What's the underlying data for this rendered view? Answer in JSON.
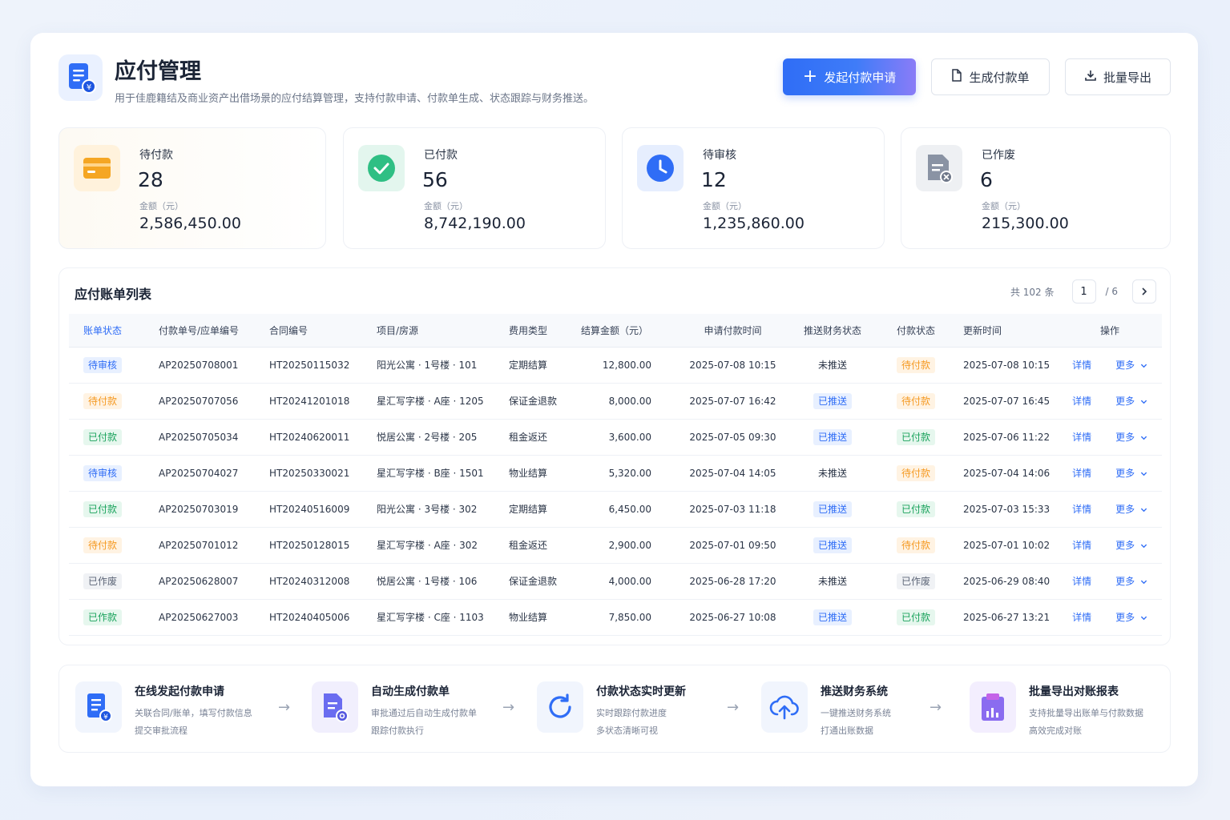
{
  "header": {
    "title": "应付管理",
    "description": "用于佳鹿籍结及商业资产出借场景的应付结算管理，支持付款申请、付款单生成、状态跟踪与财务推送。",
    "icon": "document-yuan-icon",
    "buttons": {
      "create": "发起付款申请",
      "generate": "生成付款单",
      "export": "批量导出"
    }
  },
  "stats": [
    {
      "label": "待付款",
      "count": "28",
      "sub": "金额（元）",
      "amount": "2,586,450.00",
      "icon": "wallet-icon",
      "color": "#f5a623"
    },
    {
      "label": "已付款",
      "count": "56",
      "sub": "金额（元）",
      "amount": "8,742,190.00",
      "icon": "check-circle-icon",
      "color": "#2fbf84"
    },
    {
      "label": "待审核",
      "count": "12",
      "sub": "金额（元）",
      "amount": "1,235,860.00",
      "icon": "clock-icon",
      "color": "#2f6df6"
    },
    {
      "label": "已作废",
      "count": "6",
      "sub": "金额（元）",
      "amount": "215,300.00",
      "icon": "void-document-icon",
      "color": "#8a93a4"
    }
  ],
  "table": {
    "title": "应付账单列表",
    "pager": {
      "total": "共 102 条",
      "current": "1",
      "pages": "/ 6"
    },
    "columns": [
      "账单状态",
      "付款单号/应单编号",
      "合同编号",
      "项目/房源",
      "费用类型",
      "结算金额（元）",
      "申请付款时间",
      "推送财务状态",
      "付款状态",
      "更新时间",
      "操作"
    ],
    "rows": [
      {
        "status": "待审核",
        "status_tone": "blue",
        "pay_no": "AP20250708001",
        "contract": "HT20250115032",
        "project": "阳光公寓 · 1号楼 · 101",
        "fee": "定期结算",
        "amount": "12,800.00",
        "apply_time": "2025-07-08 10:15",
        "push": "未推送",
        "push_tone": "plain",
        "pay_status": "待付款",
        "pay_tone": "orange",
        "updated": "2025-07-08 10:15",
        "detail": "详情",
        "more": "更多"
      },
      {
        "status": "待付款",
        "status_tone": "orange",
        "pay_no": "AP20250707056",
        "contract": "HT20241201018",
        "project": "星汇写字楼 · A座 · 1205",
        "fee": "保证金退款",
        "amount": "8,000.00",
        "apply_time": "2025-07-07 16:42",
        "push": "已推送",
        "push_tone": "blue",
        "pay_status": "待付款",
        "pay_tone": "orange",
        "updated": "2025-07-07 16:45",
        "detail": "详情",
        "more": "更多"
      },
      {
        "status": "已付款",
        "status_tone": "green",
        "pay_no": "AP20250705034",
        "contract": "HT20240620011",
        "project": "悦居公寓 · 2号楼 · 205",
        "fee": "租金返还",
        "amount": "3,600.00",
        "apply_time": "2025-07-05 09:30",
        "push": "已推送",
        "push_tone": "blue",
        "pay_status": "已付款",
        "pay_tone": "green",
        "updated": "2025-07-06 11:22",
        "detail": "详情",
        "more": "更多"
      },
      {
        "status": "待审核",
        "status_tone": "blue",
        "pay_no": "AP20250704027",
        "contract": "HT20250330021",
        "project": "星汇写字楼 · B座 · 1501",
        "fee": "物业结算",
        "amount": "5,320.00",
        "apply_time": "2025-07-04 14:05",
        "push": "未推送",
        "push_tone": "plain",
        "pay_status": "待付款",
        "pay_tone": "orange",
        "updated": "2025-07-04 14:06",
        "detail": "详情",
        "more": "更多"
      },
      {
        "status": "已付款",
        "status_tone": "green",
        "pay_no": "AP20250703019",
        "contract": "HT20240516009",
        "project": "阳光公寓 · 3号楼 · 302",
        "fee": "定期结算",
        "amount": "6,450.00",
        "apply_time": "2025-07-03 11:18",
        "push": "已推送",
        "push_tone": "blue",
        "pay_status": "已付款",
        "pay_tone": "green",
        "updated": "2025-07-03 15:33",
        "detail": "详情",
        "more": "更多"
      },
      {
        "status": "待付款",
        "status_tone": "orange",
        "pay_no": "AP20250701012",
        "contract": "HT20250128015",
        "project": "星汇写字楼 · A座 · 302",
        "fee": "租金返还",
        "amount": "2,900.00",
        "apply_time": "2025-07-01 09:50",
        "push": "已推送",
        "push_tone": "blue",
        "pay_status": "待付款",
        "pay_tone": "orange",
        "updated": "2025-07-01 10:02",
        "detail": "详情",
        "more": "更多"
      },
      {
        "status": "已作废",
        "status_tone": "gray",
        "pay_no": "AP20250628007",
        "contract": "HT20240312008",
        "project": "悦居公寓 · 1号楼 · 106",
        "fee": "保证金退款",
        "amount": "4,000.00",
        "apply_time": "2025-06-28 17:20",
        "push": "未推送",
        "push_tone": "plain",
        "pay_status": "已作废",
        "pay_tone": "gray",
        "updated": "2025-06-29 08:40",
        "detail": "详情",
        "more": "更多"
      },
      {
        "status": "已作款",
        "status_tone": "green",
        "pay_no": "AP20250627003",
        "contract": "HT20240405006",
        "project": "星汇写字楼 · C座 · 1103",
        "fee": "物业结算",
        "amount": "7,850.00",
        "apply_time": "2025-06-27 10:08",
        "push": "已推送",
        "push_tone": "blue",
        "pay_status": "已付款",
        "pay_tone": "green",
        "updated": "2025-06-27 13:21",
        "detail": "详情",
        "more": "更多"
      }
    ]
  },
  "features": [
    {
      "title": "在线发起付款申请",
      "line1": "关联合同/账单，填写付款信息",
      "line2": "提交审批流程",
      "icon": "document-yuan-icon"
    },
    {
      "title": "自动生成付款单",
      "line1": "审批通过后自动生成付款单",
      "line2": "跟踪付款执行",
      "icon": "document-gear-icon"
    },
    {
      "title": "付款状态实时更新",
      "line1": "实时跟踪付款进度",
      "line2": "多状态清晰可视",
      "icon": "refresh-icon"
    },
    {
      "title": "推送财务系统",
      "line1": "一键推送财务系统",
      "line2": "打通出账数据",
      "icon": "cloud-upload-icon"
    },
    {
      "title": "批量导出对账报表",
      "line1": "支持批量导出账单与付款数据",
      "line2": "高效完成对账",
      "icon": "report-chart-icon"
    }
  ],
  "colors": {
    "primary": "#2f6df6",
    "orange": "#f59a23",
    "green": "#1aa35c",
    "gray": "#5d6678"
  }
}
